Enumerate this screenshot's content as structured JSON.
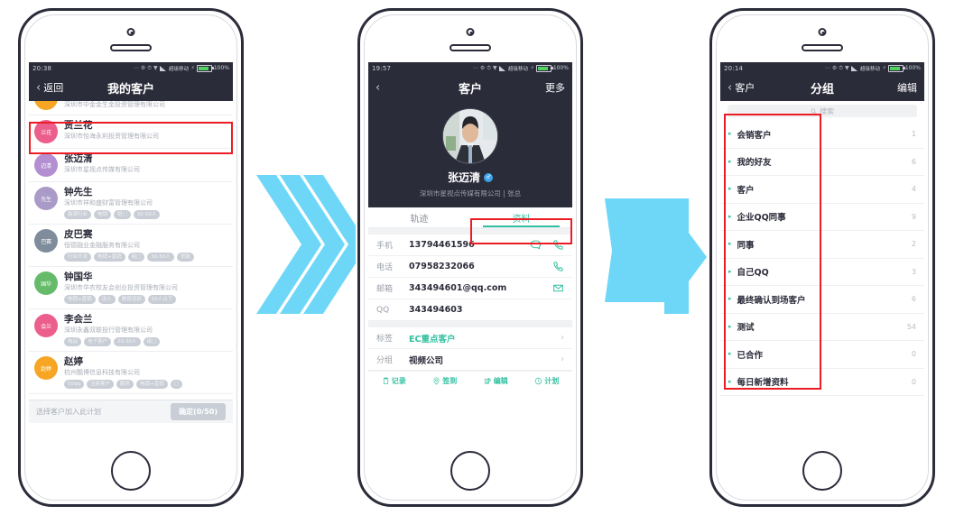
{
  "meta": {
    "accent_green": "#31c0a0",
    "dark": "#2b2c3a",
    "highlight_red": "#ec1c24",
    "arrow_blue": "#6ed7f8"
  },
  "phone1": {
    "status": {
      "time": "20:38",
      "carrier": "超级移动",
      "battery": "100%"
    },
    "nav": {
      "back_label": "返回",
      "title": "我的客户"
    },
    "list": [
      {
        "initials": "",
        "avatar_color": "#f6a623",
        "name": "",
        "company": "深圳市中金金生金投资管理有限公司",
        "tags": [],
        "clipped": true
      },
      {
        "initials": "兰花",
        "avatar_color": "#ec5f8d",
        "name": "贾兰花",
        "company": "深圳市怡海永利投资管理有限公司",
        "tags": []
      },
      {
        "initials": "迈清",
        "avatar_color": "#b38fd1",
        "name": "张迈清",
        "company": "深圳市星视点传媒有限公司",
        "tags": [],
        "highlighted": true
      },
      {
        "initials": "先生",
        "avatar_color": "#a99ac7",
        "name": "钟先生",
        "company": "深圳市祥和盛财富管理有限公司",
        "tags": [
          "能源行业",
          "电销",
          "组□",
          "30-50人"
        ]
      },
      {
        "initials": "巴赛",
        "avatar_color": "#7f8c9b",
        "name": "皮巴赛",
        "company": "恒德融业金融服务有限公司",
        "tags": [
          "行业开发",
          "电销+直销",
          "组□",
          "30-50人",
          "贷款"
        ]
      },
      {
        "initials": "国华",
        "avatar_color": "#66bb6a",
        "name": "钟国华",
        "company": "深圳市华农校友会创业投资管理有限公司",
        "tags": [
          "电销+直销",
          "法人",
          "教育培训",
          "10人以下"
        ]
      },
      {
        "initials": "会兰",
        "avatar_color": "#ec5f8d",
        "name": "李会兰",
        "company": "深圳永鑫双联投行管理有限公司",
        "tags": [
          "电话",
          "电子客户",
          "20-30人",
          "组□"
        ]
      },
      {
        "initials": "赵婷",
        "avatar_color": "#f6a623",
        "name": "赵婷",
        "company": "杭州酷博信息科技有限公司",
        "tags": [
          "50qq",
          "注册客户",
          "服务",
          "电销+直销",
          "□"
        ]
      }
    ],
    "bottom": {
      "hint": "选择客户加入此计划",
      "confirm": "确定(0/50)"
    }
  },
  "phone2": {
    "status": {
      "time": "19:57",
      "carrier": "超级移动",
      "battery": "100%"
    },
    "nav": {
      "back_label": "",
      "title": "客户",
      "right_label": "更多"
    },
    "profile": {
      "name": "张迈清",
      "gender_icon": "male-badge",
      "subtitle": "深圳市星视点传媒有限公司 | 张总"
    },
    "tabs": [
      {
        "label": "轨迹",
        "active": false
      },
      {
        "label": "资料",
        "active": true
      }
    ],
    "details": [
      {
        "label": "手机",
        "value": "13794461596",
        "icons": [
          "chat-icon",
          "phone-icon"
        ]
      },
      {
        "label": "电话",
        "value": "07958232066",
        "icons": [
          "phone-icon"
        ]
      },
      {
        "label": "邮箱",
        "value": "343494601@qq.com",
        "icons": [
          "mail-icon"
        ]
      },
      {
        "label": "QQ",
        "value": "343494603",
        "icons": []
      }
    ],
    "meta_rows": [
      {
        "label": "标签",
        "value": "EC重点客户",
        "green": true
      },
      {
        "label": "分组",
        "value": "视频公司",
        "green": false
      }
    ],
    "actions": [
      {
        "icon": "note-icon",
        "label": "记录"
      },
      {
        "icon": "location-icon",
        "label": "签到"
      },
      {
        "icon": "edit-icon",
        "label": "编辑"
      },
      {
        "icon": "clock-icon",
        "label": "计划"
      }
    ]
  },
  "phone3": {
    "status": {
      "time": "20:14",
      "carrier": "超级移动",
      "battery": "100%"
    },
    "nav": {
      "back_label": "客户",
      "title": "分组",
      "right_label": "编辑"
    },
    "search": {
      "placeholder": "搜索",
      "icon": "search-icon"
    },
    "groups": [
      {
        "label": "会销客户",
        "count": "1"
      },
      {
        "label": "我的好友",
        "count": "6"
      },
      {
        "label": "客户",
        "count": "4"
      },
      {
        "label": "企业QQ同事",
        "count": "9"
      },
      {
        "label": "同事",
        "count": "2"
      },
      {
        "label": "自己QQ",
        "count": "3"
      },
      {
        "label": "最终确认到场客户",
        "count": "6"
      },
      {
        "label": "测试",
        "count": "54"
      },
      {
        "label": "已合作",
        "count": "0"
      },
      {
        "label": "每日新增资料",
        "count": "0"
      }
    ]
  },
  "arrows": [
    {
      "name": "triple-chevron-arrow",
      "style": "chevrons"
    },
    {
      "name": "block-arrow",
      "style": "block"
    }
  ]
}
